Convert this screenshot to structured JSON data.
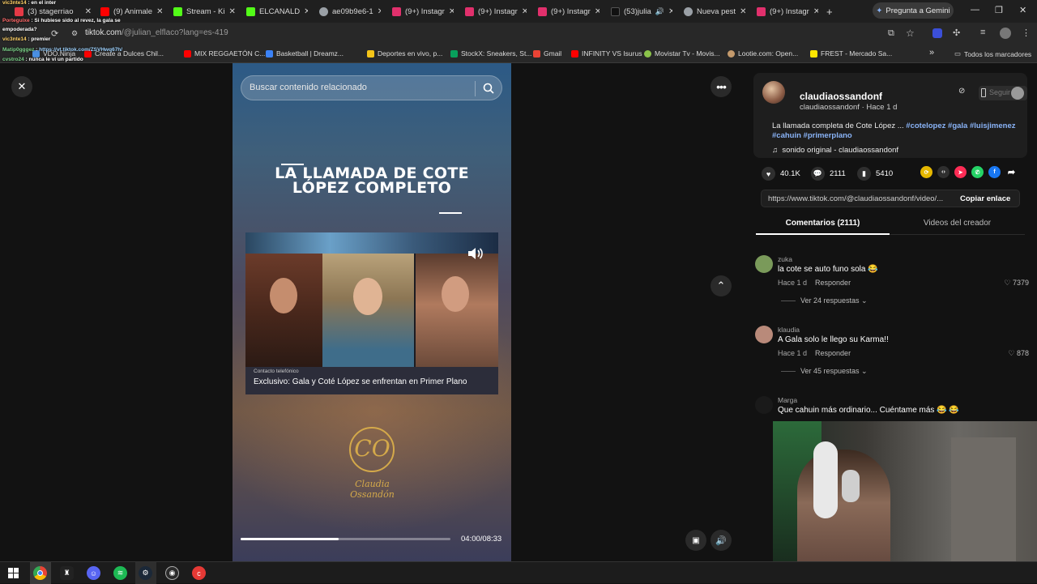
{
  "browser": {
    "tabs": [
      {
        "label": "(3) stagerriao",
        "color": "#e63946"
      },
      {
        "label": "(9) Animale",
        "color": "#ff0000"
      },
      {
        "label": "Stream - Ki",
        "color": "#53fc18"
      },
      {
        "label": "ELCANALD",
        "color": "#53fc18"
      },
      {
        "label": "ae09b9e6-1",
        "color": "#9aa0a6"
      },
      {
        "label": "(9+) Instagr",
        "color": "#e1306c"
      },
      {
        "label": "(9+) Instagr",
        "color": "#e1306c"
      },
      {
        "label": "(9+) Instagr",
        "color": "#e1306c"
      },
      {
        "label": "(53)julia",
        "color": "#111111"
      },
      {
        "label": "Nueva pest",
        "color": "#9aa0a6"
      },
      {
        "label": "(9+) Instagr",
        "color": "#e1306c"
      }
    ],
    "new_tab": "+",
    "gemini_button": "Pregunta a Gemini",
    "url_host": "tiktok.com",
    "url_path": "/@julian_elflaco?lang=es-419",
    "bookmarks": [
      {
        "label": "VDO.Ninja",
        "color": "#4a90e2"
      },
      {
        "label": "Create a Dulces Chil...",
        "color": "#ff0000"
      },
      {
        "label": "MIX REGGAETÓN C...",
        "color": "#ff0000"
      },
      {
        "label": "Basketball | Dreamz...",
        "color": "#3b82f6"
      },
      {
        "label": "Deportes en vivo, p...",
        "color": "#f5c518"
      },
      {
        "label": "StockX: Sneakers, St...",
        "color": "#08a05c"
      },
      {
        "label": "Gmail",
        "color": "#ea4335"
      },
      {
        "label": "INFINITY VS Isurus",
        "color": "#ff0000"
      },
      {
        "label": "Movistar Tv - Movis...",
        "color": "#8bc34a"
      },
      {
        "label": "Lootie.com: Open...",
        "color": "#c49a6c"
      },
      {
        "label": "FREST - Mercado Sa...",
        "color": "#ffe600"
      }
    ],
    "more_bookmarks": "»",
    "all_bookmarks": "Todos los marcadores"
  },
  "stream_chat": [
    {
      "user": "vic3nte14",
      "msg": "en el inter",
      "color": "#ffd166"
    },
    {
      "user": "Porteguixe",
      "msg": "Si hubiese sido al revez, la gala se",
      "color": "#ff6b6b"
    },
    {
      "user": "",
      "msg": "empoderada?",
      "color": "#ffffff"
    },
    {
      "user": "vic3nte14",
      "msg": "premier",
      "color": "#ffd166"
    },
    {
      "user": "Matip0gggez",
      "msg": "https://vt.tiktok.com/ZSVHwq67h/",
      "color": "#7bd389"
    },
    {
      "user": "cvstro24",
      "msg": "nunca le vi un partido",
      "color": "#7bd389"
    }
  ],
  "video": {
    "search_placeholder": "Buscar contenido relacionado",
    "headline": "LA LLAMADA DE COTE LÓPEZ COMPLETO",
    "clip_tag": "Contacto telefónico",
    "clip_title": "Exclusivo: Gala y Coté López se enfrentan en Primer Plano",
    "logo_initials": "CO",
    "logo_name": "Claudia Ossandón",
    "time": "04:00/08:33",
    "progress": 0.468
  },
  "post": {
    "username": "claudiaossandonf",
    "subline": "claudiaossandonf · Hace 1 d",
    "desc_text": "La llamada completa de Cote López ... ",
    "hashtags": [
      "#cotelopez",
      "#gala",
      "#luisjimenez",
      "#cahuin",
      "#primerplano"
    ],
    "sound": "sonido original - claudiaossandonf",
    "likes": "40.1K",
    "comments": "2111",
    "saves": "5410",
    "link": "https://www.tiktok.com/@claudiaossandonf/video/...",
    "copy_label": "Copiar enlace",
    "follow_label": "Seguir"
  },
  "tabs": {
    "comments_label": "Comentarios (2111)",
    "creator_label": "Videos del creador"
  },
  "comments": [
    {
      "user": "zuka",
      "text": "la cote se auto funo sola 😂",
      "time": "Hace 1 d",
      "reply": "Responder",
      "likes": "7379",
      "more": "Ver 24 respuestas ⌄",
      "avatar": "#7a9a5a"
    },
    {
      "user": "klaudia",
      "text": "A Gala solo le llego su Karma!!",
      "time": "Hace 1 d",
      "reply": "Responder",
      "likes": "878",
      "more": "Ver 45 respuestas ⌄",
      "avatar": "#b98a7a"
    },
    {
      "user": "Marga",
      "text": "Que cahuin más ordinario... Cuéntame más 😂 😂",
      "avatar": "#1a1a1a"
    }
  ],
  "taskbar": {
    "apps": [
      {
        "name": "windows-start",
        "color": "#ffffff"
      },
      {
        "name": "chrome",
        "color": "#4285f4"
      },
      {
        "name": "app-black",
        "color": "#222222"
      },
      {
        "name": "discord",
        "color": "#5865f2"
      },
      {
        "name": "spotify",
        "color": "#1db954"
      },
      {
        "name": "steam",
        "color": "#1b2838"
      },
      {
        "name": "obs",
        "color": "#2b2b2b"
      },
      {
        "name": "app-red",
        "color": "#e53935"
      }
    ]
  }
}
